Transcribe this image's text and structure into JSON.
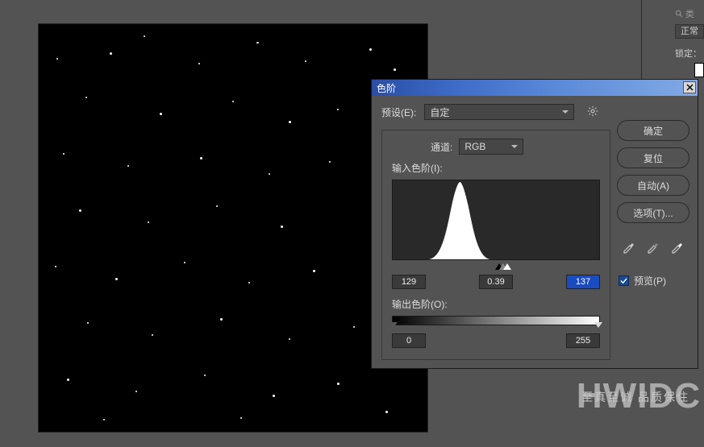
{
  "right_panel": {
    "search_placeholder": "类",
    "mode": "正常",
    "lock_label": "锁定："
  },
  "dialog": {
    "title": "色阶",
    "preset_label": "预设(E):",
    "preset_value": "自定",
    "gear_icon": "gear-icon",
    "channel_label": "通道:",
    "channel_value": "RGB",
    "input_label": "输入色阶(I):",
    "input_black": "129",
    "input_gamma": "0.39",
    "input_white": "137",
    "output_label": "输出色阶(O):",
    "output_black": "0",
    "output_white": "255",
    "buttons": {
      "ok": "确定",
      "reset": "复位",
      "auto": "自动(A)",
      "options": "选项(T)..."
    },
    "preview_label": "预览(P)",
    "preview_checked": true
  },
  "watermark": {
    "brand": "HWIDC",
    "tagline": "至真至诚 品质保住"
  },
  "colors": {
    "dialog_bg": "#535353",
    "titlebar_start": "#2a4ea5",
    "titlebar_end": "#83aae5",
    "input_selected": "#1a4bbf"
  }
}
